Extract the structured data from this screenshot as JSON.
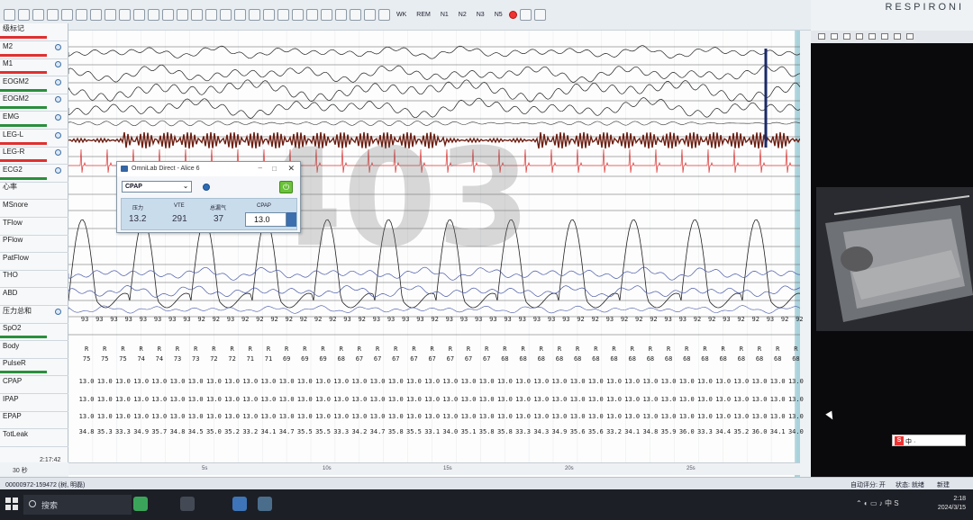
{
  "toolbar": {
    "stages": [
      "WK",
      "REM",
      "N1",
      "N2",
      "N3",
      "N5"
    ],
    "brand": "RESPIRONI"
  },
  "channels": [
    {
      "name": "级标记",
      "color": "#e03030"
    },
    {
      "name": "M2",
      "color": "#e03030"
    },
    {
      "name": "M1",
      "color": "#e03030"
    },
    {
      "name": "EOGM2",
      "color": "#2a8f3c"
    },
    {
      "name": "EOGM2",
      "color": "#2a8f3c"
    },
    {
      "name": "EMG",
      "color": "#2a8f3c"
    },
    {
      "name": "LEG-L",
      "color": "#e03030"
    },
    {
      "name": "LEG-R",
      "color": "#e03030"
    },
    {
      "name": "ECG2",
      "color": "#2a8f3c"
    },
    {
      "name": "心率",
      "color": ""
    },
    {
      "name": "MSnore",
      "color": ""
    },
    {
      "name": "TFlow",
      "color": ""
    },
    {
      "name": "PFlow",
      "color": ""
    },
    {
      "name": "PatFlow",
      "color": ""
    },
    {
      "name": "THO",
      "color": ""
    },
    {
      "name": "ABD",
      "color": ""
    },
    {
      "name": "压力总和",
      "color": ""
    },
    {
      "name": "SpO2",
      "color": "#2a8f3c"
    },
    {
      "name": "Body",
      "color": ""
    },
    {
      "name": "PulseR",
      "color": "#2a8f3c"
    },
    {
      "name": "CPAP",
      "color": ""
    },
    {
      "name": "IPAP",
      "color": ""
    },
    {
      "name": "EPAP",
      "color": ""
    },
    {
      "name": "TotLeak",
      "color": ""
    }
  ],
  "watermark": "403",
  "spo2_values": [
    "93",
    "93",
    "93",
    "93",
    "93",
    "93",
    "93",
    "93",
    "92",
    "92",
    "93",
    "92",
    "92",
    "92",
    "92",
    "92",
    "92",
    "92",
    "93",
    "92",
    "93",
    "93",
    "93",
    "93",
    "92",
    "93",
    "93",
    "93",
    "93",
    "93",
    "93",
    "93",
    "93",
    "93",
    "92",
    "92",
    "93",
    "92",
    "92",
    "92",
    "93",
    "93",
    "92",
    "92",
    "93",
    "92",
    "92",
    "93",
    "92",
    "92"
  ],
  "body_values": [
    "R",
    "R",
    "R",
    "R",
    "R",
    "R",
    "R",
    "R",
    "R",
    "R",
    "R",
    "R",
    "R",
    "R",
    "R",
    "R",
    "R",
    "R",
    "R",
    "R",
    "R",
    "R",
    "R",
    "R",
    "R",
    "R",
    "R",
    "R",
    "R",
    "R",
    "R",
    "R",
    "R",
    "R",
    "R",
    "R",
    "R",
    "R",
    "R",
    "R"
  ],
  "pulse_values": [
    "75",
    "75",
    "75",
    "74",
    "74",
    "73",
    "73",
    "72",
    "72",
    "71",
    "71",
    "69",
    "69",
    "69",
    "68",
    "67",
    "67",
    "67",
    "67",
    "67",
    "67",
    "67",
    "67",
    "68",
    "68",
    "68",
    "68",
    "68",
    "68",
    "68",
    "68",
    "68",
    "68",
    "68",
    "68",
    "68",
    "68",
    "68",
    "68",
    "68"
  ],
  "cpap_values": [
    "13.0",
    "13.0",
    "13.0",
    "13.0",
    "13.0",
    "13.0",
    "13.0",
    "13.0",
    "13.0",
    "13.0",
    "13.0",
    "13.0",
    "13.0",
    "13.0",
    "13.0",
    "13.0",
    "13.0",
    "13.0",
    "13.0",
    "13.0",
    "13.0",
    "13.0",
    "13.0",
    "13.0",
    "13.0",
    "13.0",
    "13.0",
    "13.0",
    "13.0",
    "13.0",
    "13.0",
    "13.0",
    "13.0",
    "13.0",
    "13.0",
    "13.0",
    "13.0",
    "13.0",
    "13.0",
    "13.0"
  ],
  "ipap_values": [
    "13.0",
    "13.0",
    "13.0",
    "13.0",
    "13.0",
    "13.0",
    "13.0",
    "13.0",
    "13.0",
    "13.0",
    "13.0",
    "13.0",
    "13.0",
    "13.0",
    "13.0",
    "13.0",
    "13.0",
    "13.0",
    "13.0",
    "13.0",
    "13.0",
    "13.0",
    "13.0",
    "13.0",
    "13.0",
    "13.0",
    "13.0",
    "13.0",
    "13.0",
    "13.0",
    "13.0",
    "13.0",
    "13.0",
    "13.0",
    "13.0",
    "13.0",
    "13.0",
    "13.0",
    "13.0",
    "13.0"
  ],
  "epap_values": [
    "13.0",
    "13.0",
    "13.0",
    "13.0",
    "13.0",
    "13.0",
    "13.0",
    "13.0",
    "13.0",
    "13.0",
    "13.0",
    "13.0",
    "13.0",
    "13.0",
    "13.0",
    "13.0",
    "13.0",
    "13.0",
    "13.0",
    "13.0",
    "13.0",
    "13.0",
    "13.0",
    "13.0",
    "13.0",
    "13.0",
    "13.0",
    "13.0",
    "13.0",
    "13.0",
    "13.0",
    "13.0",
    "13.0",
    "13.0",
    "13.0",
    "13.0",
    "13.0",
    "13.0",
    "13.0",
    "13.0"
  ],
  "leak_values": [
    "34.8",
    "35.3",
    "33.3",
    "34.9",
    "35.7",
    "34.8",
    "34.5",
    "35.0",
    "35.2",
    "33.2",
    "34.1",
    "34.7",
    "35.5",
    "35.5",
    "33.3",
    "34.2",
    "34.7",
    "35.8",
    "35.5",
    "33.1",
    "34.0",
    "35.1",
    "35.8",
    "35.8",
    "33.3",
    "34.3",
    "34.9",
    "35.6",
    "35.6",
    "33.2",
    "34.1",
    "34.8",
    "35.9",
    "36.0",
    "33.3",
    "34.4",
    "35.2",
    "36.0",
    "34.1",
    "34.0"
  ],
  "timebar": {
    "left_time": "2:17:42",
    "ticks": [
      "5s",
      "10s",
      "15s",
      "20s",
      "25s"
    ],
    "epoch": "30 秒"
  },
  "cpap_dialog": {
    "title": "OmniLab Direct - Alice 6",
    "mode": "CPAP",
    "labels": {
      "pressure": "压力",
      "vte": "VTE",
      "leak": "总漏气",
      "cpap": "CPAP"
    },
    "values": {
      "pressure": "13.2",
      "vte": "291",
      "leak": "37",
      "cpap_set": "13.0"
    }
  },
  "statusbar": {
    "left": "00000972-159472 (树, 明磊)",
    "right1": "自动评分: 开",
    "right2": "状态: 就绪",
    "right3": "新建"
  },
  "taskbar": {
    "search": "搜索",
    "time": "2:18",
    "date": "2024/3/15"
  },
  "ime": "中 ·"
}
